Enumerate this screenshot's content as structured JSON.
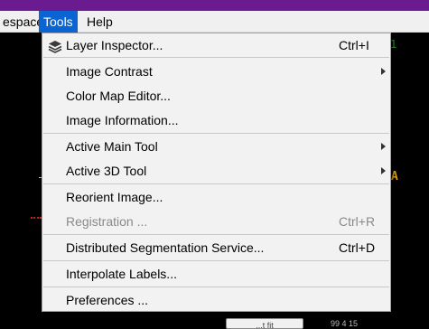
{
  "menubar": {
    "workspace_label": "espace",
    "tools_label": "Tools",
    "help_label": "Help"
  },
  "viewer": {
    "green_mark": "1",
    "orange_mark": "A",
    "bottom_widget_label": "...t fit",
    "bottom_text": "99  4 15"
  },
  "tools_menu": {
    "items": [
      {
        "label": "Layer Inspector...",
        "shortcut": "Ctrl+I",
        "icon": "layers-icon"
      },
      {
        "label": "Image Contrast",
        "submenu": true
      },
      {
        "label": "Color Map Editor..."
      },
      {
        "label": "Image Information..."
      },
      {
        "label": "Active Main Tool",
        "submenu": true
      },
      {
        "label": "Active 3D Tool",
        "submenu": true
      },
      {
        "label": "Reorient Image..."
      },
      {
        "label": "Registration ...",
        "shortcut": "Ctrl+R",
        "disabled": true
      },
      {
        "label": "Distributed Segmentation Service...",
        "shortcut": "Ctrl+D"
      },
      {
        "label": "Interpolate Labels..."
      },
      {
        "label": "Preferences ..."
      }
    ]
  },
  "colors": {
    "menu_highlight": "#0a64d2",
    "menu_background": "#f2f2f2",
    "disabled_text": "#8a8a8a",
    "window_accent": "#6a1b8f"
  }
}
